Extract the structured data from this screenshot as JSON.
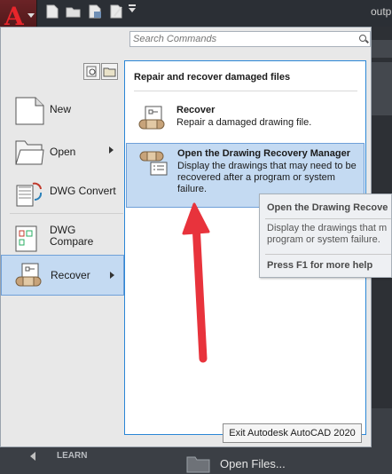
{
  "topbar": {
    "app_letter": "A",
    "right_text": "outpu"
  },
  "search": {
    "placeholder": "Search Commands"
  },
  "left_menu": {
    "items": [
      {
        "label": "New"
      },
      {
        "label": "Open"
      },
      {
        "label": "DWG Convert"
      },
      {
        "label": "DWG\nCompare"
      },
      {
        "label": "Recover"
      }
    ]
  },
  "submenu": {
    "heading": "Repair and recover damaged files",
    "items": [
      {
        "title": "Recover",
        "description": "Repair a damaged drawing file."
      },
      {
        "title": "Open the Drawing Recovery Manager",
        "description": "Display the drawings that may need to be recovered after a program or system failure."
      }
    ]
  },
  "tooltip": {
    "title": "Open the Drawing Recove",
    "description_line1": "Display the drawings that m",
    "description_line2": "program or system failure.",
    "help": "Press F1 for more help"
  },
  "exit_button": "Exit Autodesk AutoCAD 2020",
  "bottom": {
    "learn": "LEARN",
    "open_files": "Open Files..."
  },
  "colors": {
    "selection": "#c4daf2",
    "submenu_border": "#2b86d6",
    "arrow": "#e8333c",
    "app_red": "#e8252b"
  }
}
